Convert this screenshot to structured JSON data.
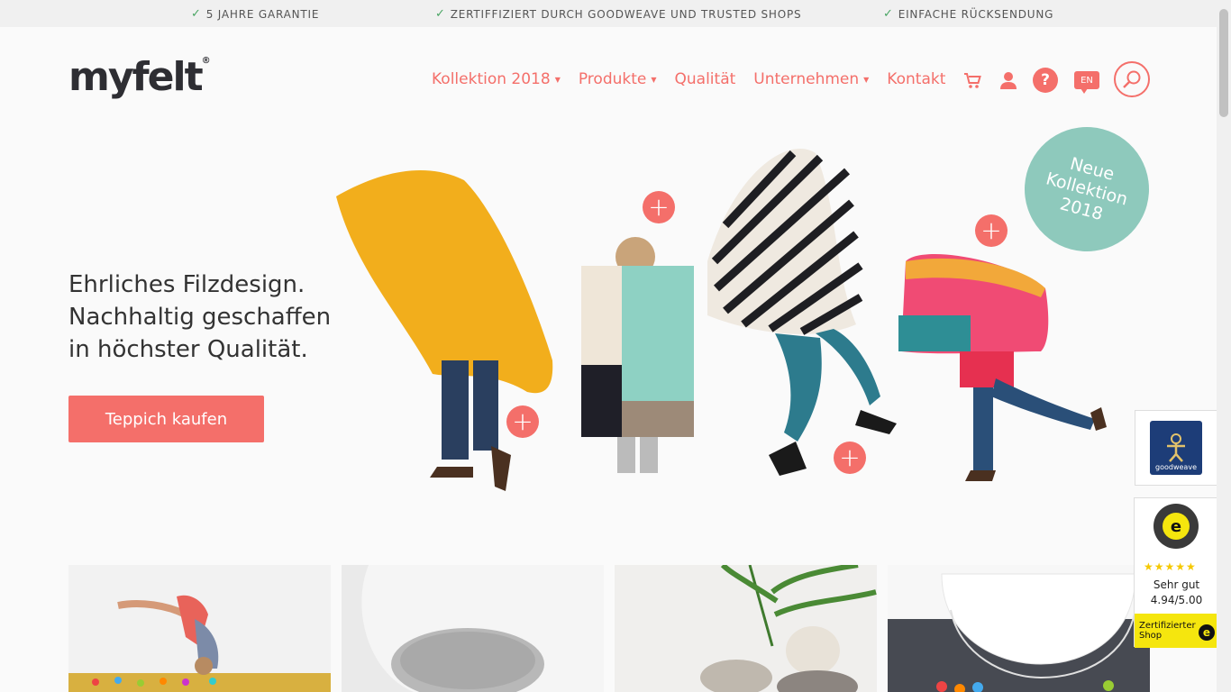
{
  "usp_bar": {
    "items": [
      "5 JAHRE GARANTIE",
      "ZERTIFFIZIERT DURCH GOODWEAVE UND TRUSTED SHOPS",
      "EINFACHE RÜCKSENDUNG"
    ]
  },
  "header": {
    "logo": "myfelt",
    "logo_mark": "®",
    "nav": [
      "Kollektion 2018",
      "Produkte",
      "Qualität",
      "Unternehmen",
      "Kontakt"
    ],
    "help_label": "?",
    "lang_label": "EN"
  },
  "hero": {
    "headline_lines": [
      "Ehrliches Filzdesign.",
      "Nachhaltig geschaffen",
      "in höchster Qualität."
    ],
    "cta_label": "Teppich kaufen",
    "badge_lines": [
      "Neue",
      "Kollektion",
      "2018"
    ]
  },
  "widgets": {
    "goodweave_label": "goodweave",
    "trusted_rating": "Sehr gut",
    "trusted_score": "4.94/5.00",
    "trusted_footer": "Zertifizierter Shop",
    "trusted_e": "e",
    "trusted_stars": "★★★★★"
  },
  "colors": {
    "accent": "#f46f6a",
    "badge": "#8ec9bc",
    "check": "#4aa564"
  }
}
